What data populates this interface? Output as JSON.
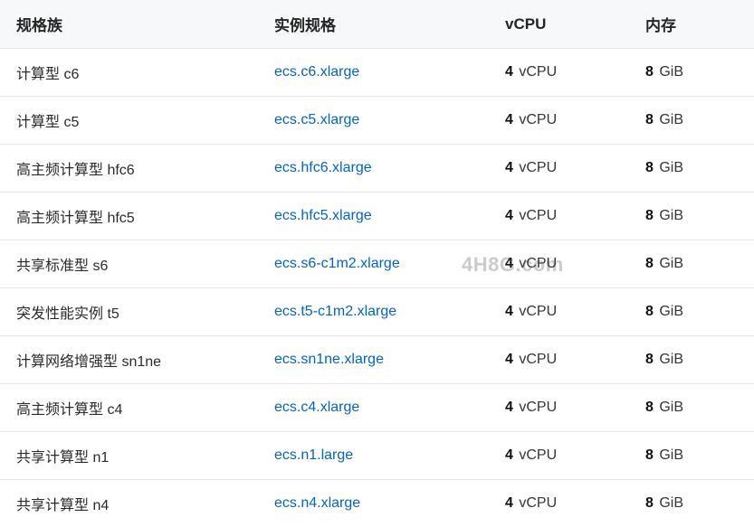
{
  "table": {
    "headers": {
      "family": "规格族",
      "spec": "实例规格",
      "vcpu": "vCPU",
      "memory": "内存"
    },
    "units": {
      "vcpu": "vCPU",
      "memory": "GiB"
    },
    "rows": [
      {
        "family": "计算型 c6",
        "spec": "ecs.c6.xlarge",
        "vcpu": "4",
        "memory": "8"
      },
      {
        "family": "计算型 c5",
        "spec": "ecs.c5.xlarge",
        "vcpu": "4",
        "memory": "8"
      },
      {
        "family": "高主频计算型 hfc6",
        "spec": "ecs.hfc6.xlarge",
        "vcpu": "4",
        "memory": "8"
      },
      {
        "family": "高主频计算型 hfc5",
        "spec": "ecs.hfc5.xlarge",
        "vcpu": "4",
        "memory": "8"
      },
      {
        "family": "共享标准型 s6",
        "spec": "ecs.s6-c1m2.xlarge",
        "vcpu": "4",
        "memory": "8"
      },
      {
        "family": "突发性能实例 t5",
        "spec": "ecs.t5-c1m2.xlarge",
        "vcpu": "4",
        "memory": "8"
      },
      {
        "family": "计算网络增强型 sn1ne",
        "spec": "ecs.sn1ne.xlarge",
        "vcpu": "4",
        "memory": "8"
      },
      {
        "family": "高主频计算型 c4",
        "spec": "ecs.c4.xlarge",
        "vcpu": "4",
        "memory": "8"
      },
      {
        "family": "共享计算型 n1",
        "spec": "ecs.n1.large",
        "vcpu": "4",
        "memory": "8"
      },
      {
        "family": "共享计算型 n4",
        "spec": "ecs.n4.xlarge",
        "vcpu": "4",
        "memory": "8"
      }
    ]
  },
  "watermark": "4H8G.com",
  "chart_data": {
    "type": "table",
    "columns": [
      "规格族",
      "实例规格",
      "vCPU",
      "内存"
    ],
    "rows": [
      [
        "计算型 c6",
        "ecs.c6.xlarge",
        "4 vCPU",
        "8 GiB"
      ],
      [
        "计算型 c5",
        "ecs.c5.xlarge",
        "4 vCPU",
        "8 GiB"
      ],
      [
        "高主频计算型 hfc6",
        "ecs.hfc6.xlarge",
        "4 vCPU",
        "8 GiB"
      ],
      [
        "高主频计算型 hfc5",
        "ecs.hfc5.xlarge",
        "4 vCPU",
        "8 GiB"
      ],
      [
        "共享标准型 s6",
        "ecs.s6-c1m2.xlarge",
        "4 vCPU",
        "8 GiB"
      ],
      [
        "突发性能实例 t5",
        "ecs.t5-c1m2.xlarge",
        "4 vCPU",
        "8 GiB"
      ],
      [
        "计算网络增强型 sn1ne",
        "ecs.sn1ne.xlarge",
        "4 vCPU",
        "8 GiB"
      ],
      [
        "高主频计算型 c4",
        "ecs.c4.xlarge",
        "4 vCPU",
        "8 GiB"
      ],
      [
        "共享计算型 n1",
        "ecs.n1.large",
        "4 vCPU",
        "8 GiB"
      ],
      [
        "共享计算型 n4",
        "ecs.n4.xlarge",
        "4 vCPU",
        "8 GiB"
      ]
    ]
  }
}
